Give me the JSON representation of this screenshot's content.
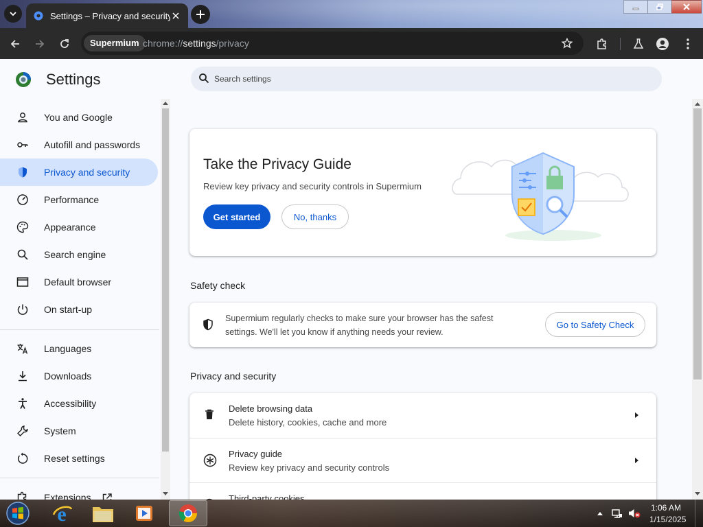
{
  "tab": {
    "title": "Settings – Privacy and security"
  },
  "toolbar": {
    "chip": "Supermium",
    "url_prefix": "chrome://",
    "url_host": "settings",
    "url_path": "/privacy"
  },
  "header": {
    "title": "Settings",
    "search_placeholder": "Search settings"
  },
  "sidebar": {
    "items": [
      {
        "label": "You and Google",
        "icon": "person-icon"
      },
      {
        "label": "Autofill and passwords",
        "icon": "key-icon"
      },
      {
        "label": "Privacy and security",
        "icon": "shield-icon",
        "active": true
      },
      {
        "label": "Performance",
        "icon": "speedometer-icon"
      },
      {
        "label": "Appearance",
        "icon": "palette-icon"
      },
      {
        "label": "Search engine",
        "icon": "search-icon"
      },
      {
        "label": "Default browser",
        "icon": "browser-window-icon"
      },
      {
        "label": "On start-up",
        "icon": "power-icon"
      },
      {
        "label": "Languages",
        "icon": "translate-icon"
      },
      {
        "label": "Downloads",
        "icon": "download-icon"
      },
      {
        "label": "Accessibility",
        "icon": "accessibility-icon"
      },
      {
        "label": "System",
        "icon": "wrench-icon"
      },
      {
        "label": "Reset settings",
        "icon": "reset-icon"
      },
      {
        "label": "Extensions",
        "icon": "puzzle-icon"
      }
    ]
  },
  "privacy_guide": {
    "title": "Take the Privacy Guide",
    "description": "Review key privacy and security controls in Supermium",
    "primary_button": "Get started",
    "secondary_button": "No, thanks"
  },
  "safety_check": {
    "section_title": "Safety check",
    "text": "Supermium regularly checks to make sure your browser has the safest settings. We'll let you know if anything needs your review.",
    "button": "Go to Safety Check"
  },
  "privacy_section": {
    "title": "Privacy and security",
    "rows": [
      {
        "title": "Delete browsing data",
        "subtitle": "Delete history, cookies, cache and more",
        "icon": "trash-icon"
      },
      {
        "title": "Privacy guide",
        "subtitle": "Review key privacy and security controls",
        "icon": "privacy-guide-icon"
      },
      {
        "title": "Third-party cookies",
        "subtitle": "",
        "icon": "cookie-icon"
      }
    ]
  },
  "taskbar": {
    "time": "1:06 AM",
    "date": "1/15/2025"
  },
  "colors": {
    "accent": "#0b57d0",
    "active_nav_bg": "#d3e3fd",
    "page_bg": "#f8fafd"
  }
}
